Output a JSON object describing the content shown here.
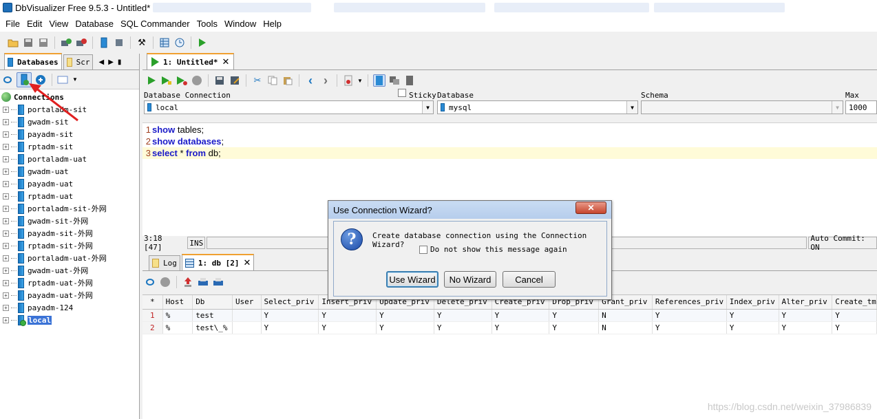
{
  "window": {
    "title": "DbVisualizer Free 9.5.3 - Untitled*"
  },
  "menu": [
    "File",
    "Edit",
    "View",
    "Database",
    "SQL Commander",
    "Tools",
    "Window",
    "Help"
  ],
  "left_tabs": {
    "databases": "Databases",
    "scripts": "Scr"
  },
  "tree": {
    "root": "Connections",
    "items": [
      "portaladm-sit",
      "gwadm-sit",
      "payadm-sit",
      "rptadm-sit",
      "portaladm-uat",
      "gwadm-uat",
      "payadm-uat",
      "rptadm-uat",
      "portaladm-sit-外网",
      "gwadm-sit-外网",
      "payadm-sit-外网",
      "rptadm-sit-外网",
      "portaladm-uat-外网",
      "gwadm-uat-外网",
      "rptadm-uat-外网",
      "payadm-uat-外网",
      "payadm-124",
      "local"
    ],
    "selected": "local"
  },
  "editor_tab": {
    "label": "1: Untitled*"
  },
  "connection": {
    "db_connection_label": "Database Connection",
    "sticky_label": "Sticky",
    "database_label": "Database",
    "schema_label": "Schema",
    "maxrows_label": "Max Rows",
    "db_connection_value": "local",
    "database_value": "mysql",
    "schema_value": "",
    "maxrows_value": "1000"
  },
  "code": [
    {
      "n": "1",
      "kw": "show",
      "rest": " tables;"
    },
    {
      "n": "2",
      "kw": "show databases",
      "rest": ";"
    },
    {
      "n": "3",
      "kw": "select",
      "mid": " * ",
      "kw2": "from",
      "rest": " db;"
    }
  ],
  "status": {
    "position": "3:18 [47]",
    "mode": "INS",
    "autocommit": "Auto Commit: ON"
  },
  "result_tabs": {
    "log": "Log",
    "grid": "1: db [2]"
  },
  "grid": {
    "corner": "*",
    "columns": [
      "Host",
      "Db",
      "User",
      "Select_priv",
      "Insert_priv",
      "Update_priv",
      "Delete_priv",
      "Create_priv",
      "Drop_priv",
      "Grant_priv",
      "References_priv",
      "Index_priv",
      "Alter_priv",
      "Create_tm"
    ],
    "rows": [
      {
        "n": "1",
        "cells": [
          "%",
          "test",
          "",
          "Y",
          "Y",
          "Y",
          "Y",
          "Y",
          "Y",
          "N",
          "Y",
          "Y",
          "Y",
          "Y"
        ]
      },
      {
        "n": "2",
        "cells": [
          "%",
          "test\\_%",
          "",
          "Y",
          "Y",
          "Y",
          "Y",
          "Y",
          "Y",
          "N",
          "Y",
          "Y",
          "Y",
          "Y"
        ]
      }
    ]
  },
  "dialog": {
    "title": "Use Connection Wizard?",
    "message": "Create database connection using the Connection Wizard?",
    "checkbox": "Do not show this message again",
    "use_wizard": "Use Wizard",
    "no_wizard": "No Wizard",
    "cancel": "Cancel"
  },
  "watermark": "https://blog.csdn.net/weixin_37986839",
  "colors": {
    "accent": "#f0a030",
    "keyword": "#1a1ac8",
    "selection": "#3b73d6",
    "annotation_arrow": "#e02020"
  }
}
